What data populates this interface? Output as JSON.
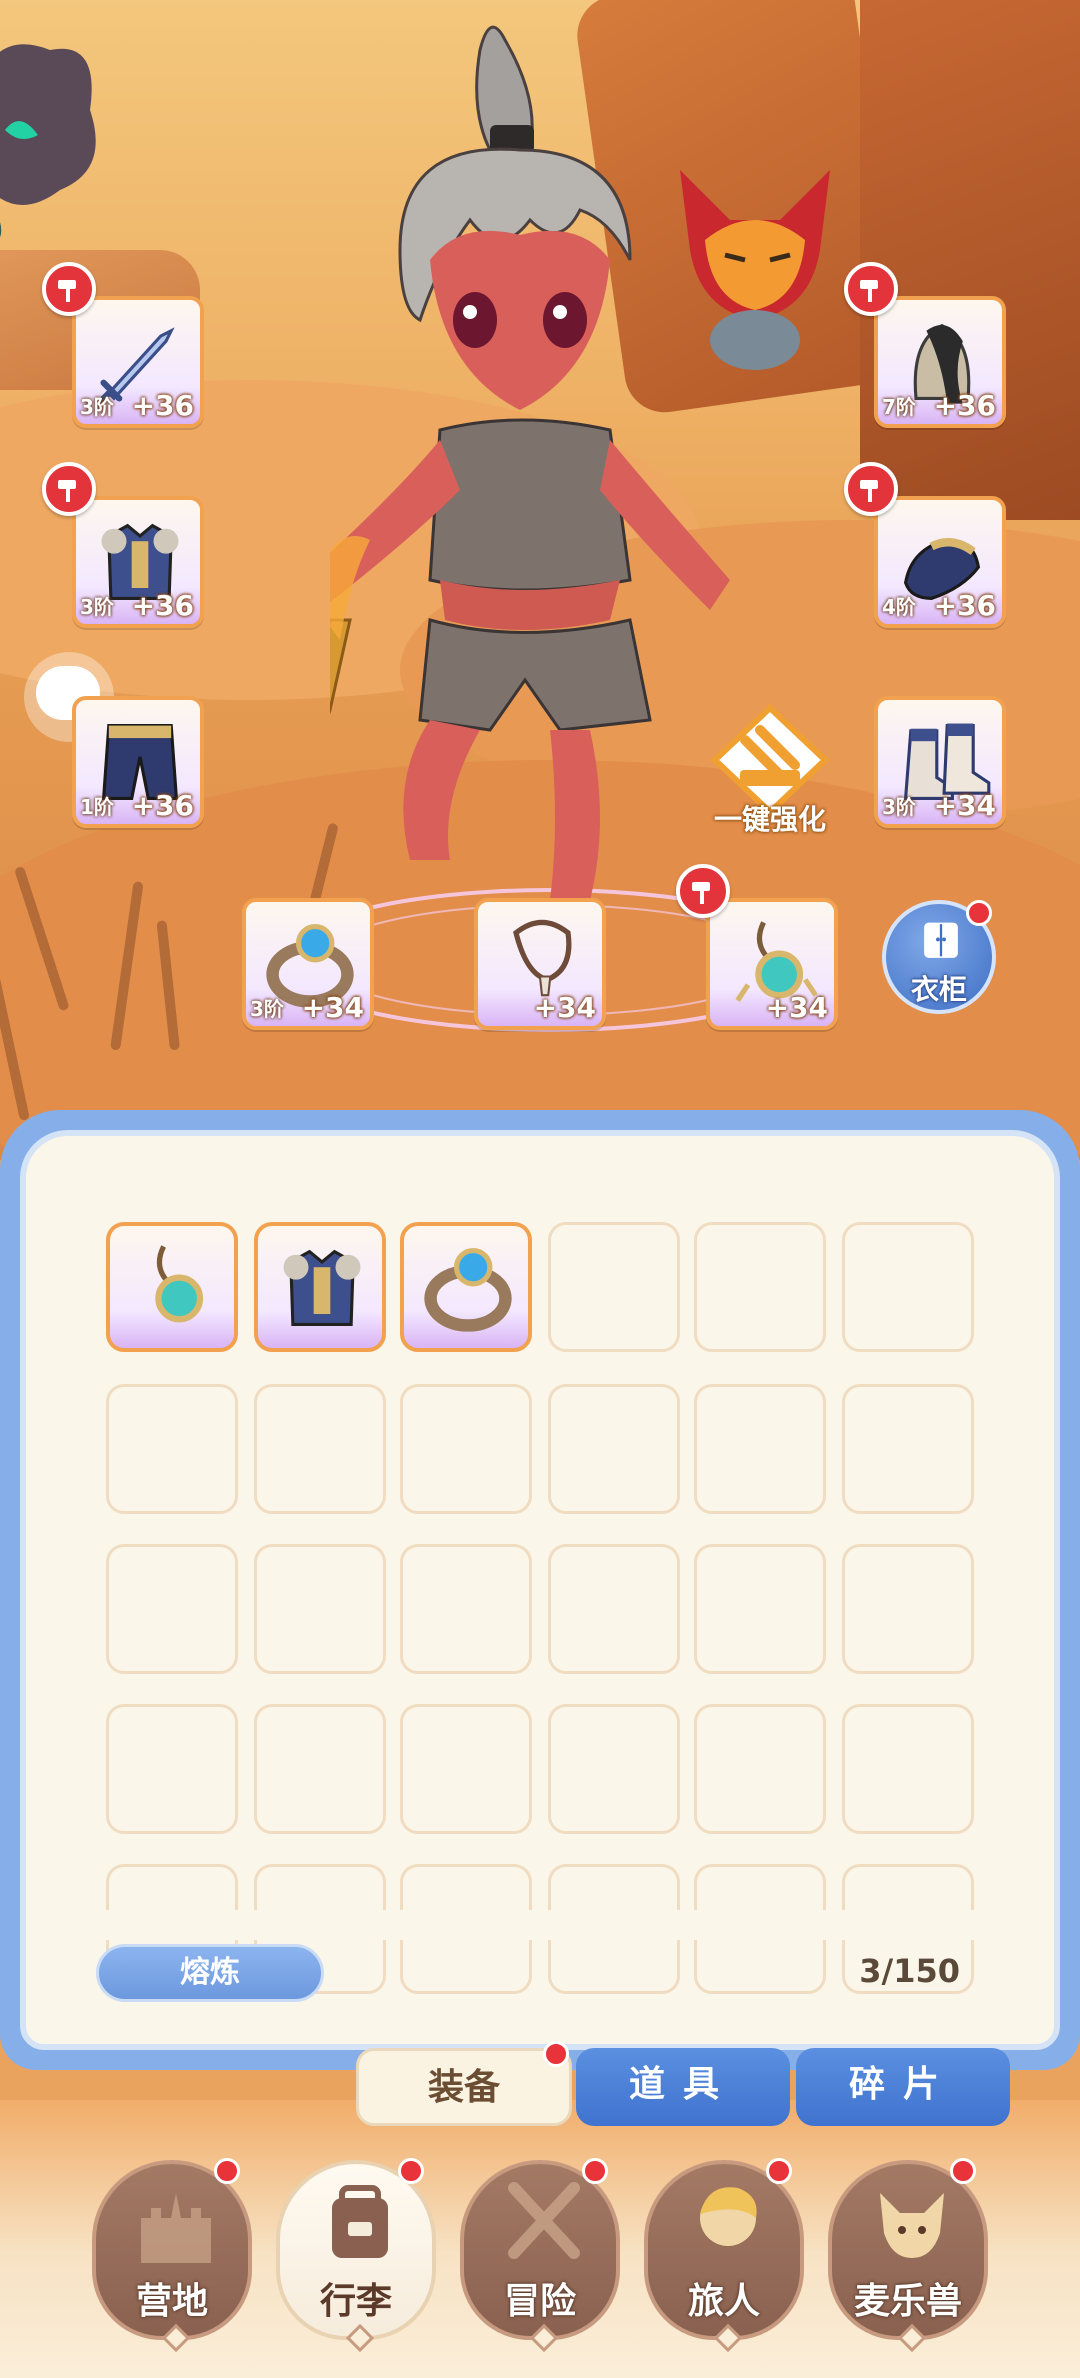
{
  "equipment_slots": [
    {
      "id": "sword",
      "tier": "3阶",
      "level": "+36",
      "upgradable": true
    },
    {
      "id": "helmet",
      "tier": "7阶",
      "level": "+36",
      "upgradable": true
    },
    {
      "id": "armor",
      "tier": "3阶",
      "level": "+36",
      "upgradable": true
    },
    {
      "id": "gauntlet",
      "tier": "4阶",
      "level": "+36",
      "upgradable": true
    },
    {
      "id": "pants",
      "tier": "1阶",
      "level": "+36",
      "upgradable": false
    },
    {
      "id": "boots",
      "tier": "3阶",
      "level": "+34",
      "upgradable": false
    },
    {
      "id": "ring",
      "tier": "3阶",
      "level": "+34",
      "upgradable": false
    },
    {
      "id": "necklace",
      "tier": "",
      "level": "+34",
      "upgradable": false
    },
    {
      "id": "amulet",
      "tier": "",
      "level": "+34",
      "upgradable": true
    }
  ],
  "one_key_enhance_label": "一键强化",
  "wardrobe_label": "衣柜",
  "inventory": {
    "items": [
      "amulet",
      "armor",
      "ring"
    ],
    "smelt_label": "熔炼",
    "capacity": "3/150"
  },
  "category_tabs": [
    {
      "label": "装备",
      "active": true,
      "badge": true
    },
    {
      "label": "道具",
      "active": false,
      "badge": false
    },
    {
      "label": "碎片",
      "active": false,
      "badge": false
    }
  ],
  "bottom_nav": [
    {
      "label": "营地",
      "icon": "castle-icon",
      "active": false,
      "badge": true
    },
    {
      "label": "行李",
      "icon": "backpack-icon",
      "active": true,
      "badge": true
    },
    {
      "label": "冒险",
      "icon": "crossed-swords-icon",
      "active": false,
      "badge": true
    },
    {
      "label": "旅人",
      "icon": "traveler-icon",
      "active": false,
      "badge": true
    },
    {
      "label": "麦乐兽",
      "icon": "pet-icon",
      "active": false,
      "badge": true
    }
  ],
  "colors": {
    "slot_border": "#f2a14e",
    "badge_red": "#e8333b",
    "panel_blue": "#86aee8",
    "tab_blue": "#3f73cf",
    "nav_brown": "#8a6150"
  }
}
